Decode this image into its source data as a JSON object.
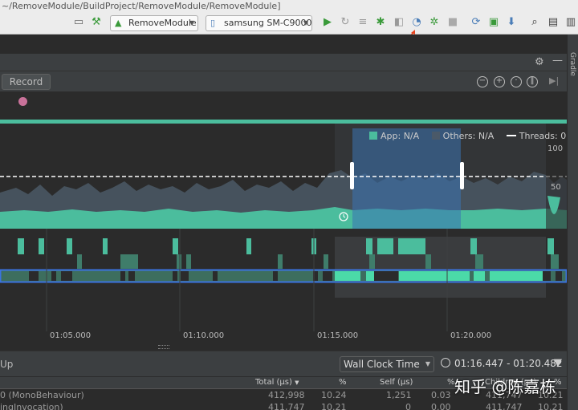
{
  "window": {
    "title": "~/RemoveModule/BuildProject/RemoveModule/RemoveModule]"
  },
  "toolbar": {
    "module_combo": "RemoveModule",
    "device_combo": "samsung SM-C9000"
  },
  "sidebar": {
    "gradle_label": "Gradle"
  },
  "profiler": {
    "record_label": "Record",
    "legend": {
      "app": "App: N/A",
      "others": "Others: N/A",
      "threads": "Threads: 0"
    },
    "y_axis": {
      "top": "100",
      "mid": "50"
    },
    "time_ticks": [
      "01:05.000",
      "01:10.000",
      "01:15.000",
      "01:20.000"
    ]
  },
  "bottom": {
    "up_label": "Up",
    "clock_combo": "Wall Clock Time",
    "range": "01:16.447 - 01:20.482",
    "columns": [
      "Total (µs)",
      "%",
      "Self (µs)",
      "%",
      "Children (µs)",
      "%"
    ],
    "rows": [
      {
        "name": "0 (MonoBehaviour)",
        "total": "412,998",
        "total_pct": "10.24",
        "self": "1,251",
        "self_pct": "0.03",
        "children": "411,747",
        "children_pct": "10.21"
      },
      {
        "name": "ingInvocation)",
        "total": "411,747",
        "total_pct": "10.21",
        "self": "0",
        "self_pct": "0.00",
        "children": "411,747",
        "children_pct": "10.21"
      }
    ]
  },
  "watermark": "知乎 @陈嘉栋",
  "colors": {
    "app": "#4bbd9d",
    "others": "#4a5968",
    "selection": "#3b73b3",
    "accent_arrow": "#e8441f"
  }
}
